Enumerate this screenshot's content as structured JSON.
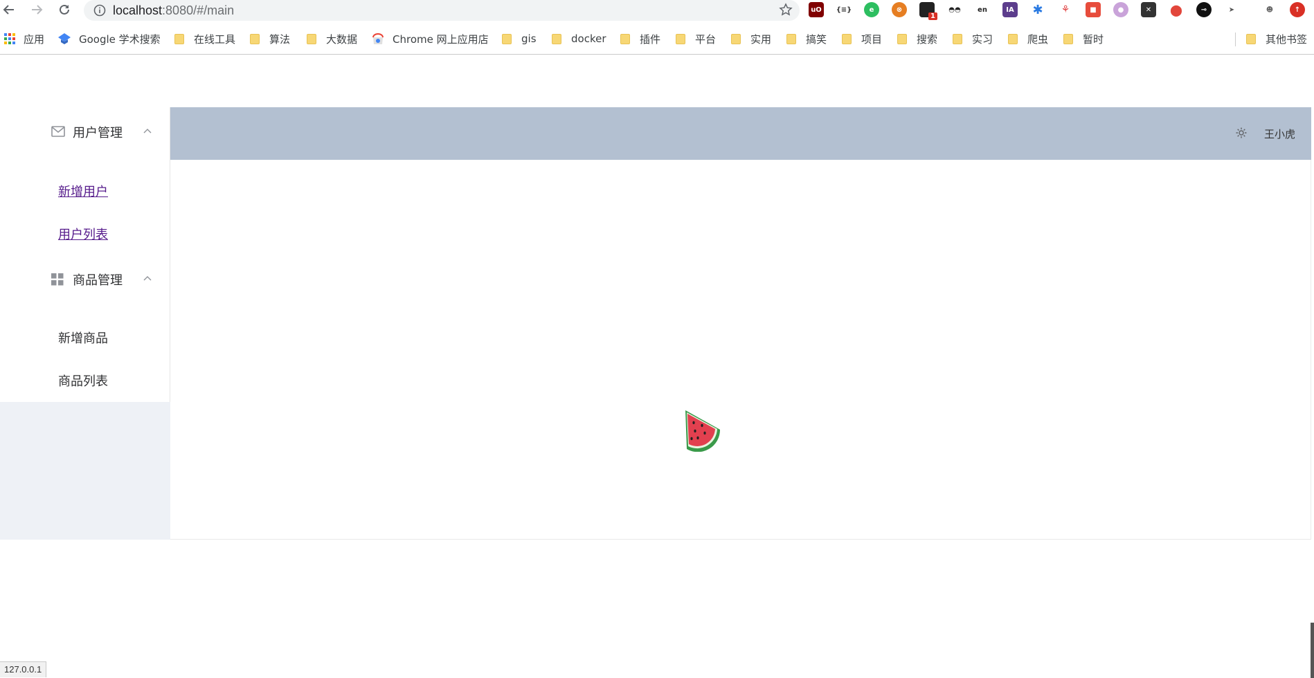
{
  "browser": {
    "url_host": "localhost",
    "url_rest": ":8080/#/main",
    "status_bar": "127.0.0.1",
    "extension_badge": "1",
    "bookmarks": [
      {
        "label": "应用",
        "type": "apps"
      },
      {
        "label": "Google 学术搜索",
        "type": "scholar"
      },
      {
        "label": "在线工具",
        "type": "folder"
      },
      {
        "label": "算法",
        "type": "folder"
      },
      {
        "label": "大数据",
        "type": "folder"
      },
      {
        "label": "Chrome 网上应用店",
        "type": "webstore"
      },
      {
        "label": "gis",
        "type": "folder"
      },
      {
        "label": "docker",
        "type": "folder"
      },
      {
        "label": "插件",
        "type": "folder"
      },
      {
        "label": "平台",
        "type": "folder"
      },
      {
        "label": "实用",
        "type": "folder"
      },
      {
        "label": "搞笑",
        "type": "folder"
      },
      {
        "label": "项目",
        "type": "folder"
      },
      {
        "label": "搜索",
        "type": "folder"
      },
      {
        "label": "实习",
        "type": "folder"
      },
      {
        "label": "爬虫",
        "type": "folder"
      },
      {
        "label": "暂时",
        "type": "folder"
      },
      {
        "label": "其他书签",
        "type": "folder"
      }
    ]
  },
  "sidebar": {
    "groups": [
      {
        "title": "用户管理",
        "icon": "message-icon",
        "items": [
          "新增用户",
          "用户列表"
        ]
      },
      {
        "title": "商品管理",
        "icon": "menu-grid-icon",
        "items": [
          "新增商品",
          "商品列表"
        ]
      }
    ]
  },
  "header": {
    "username": "王小虎",
    "icon": "gear-icon"
  },
  "main": {
    "loading_icon": "watermelon-icon"
  },
  "colors": {
    "header_bg": "#b3c0d1",
    "sidebar_bg": "#eef1f6",
    "visited_link": "#551a8b"
  }
}
